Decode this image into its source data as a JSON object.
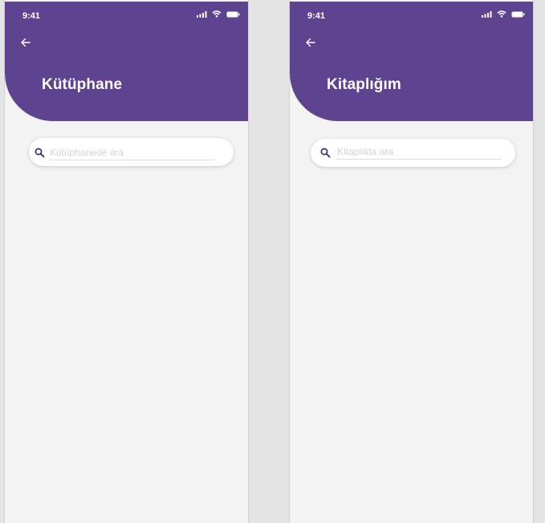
{
  "colors": {
    "header": "#5e4490",
    "background": "#f3f3f3",
    "canvas": "#e4e4e4",
    "search_icon": "#3a2f73"
  },
  "screens": [
    {
      "status_bar": {
        "time": "9:41",
        "icons": [
          "signal-icon",
          "wifi-icon",
          "battery-icon"
        ]
      },
      "back_icon": "arrow-left-icon",
      "title": "Kütüphane",
      "search": {
        "placeholder": "Kütüphanede ara",
        "value": ""
      }
    },
    {
      "status_bar": {
        "time": "9:41",
        "icons": [
          "signal-icon",
          "wifi-icon",
          "battery-icon"
        ]
      },
      "back_icon": "arrow-left-icon",
      "title": "Kitaplığım",
      "search": {
        "placeholder": "Kitaplıkta ara",
        "value": ""
      }
    }
  ]
}
